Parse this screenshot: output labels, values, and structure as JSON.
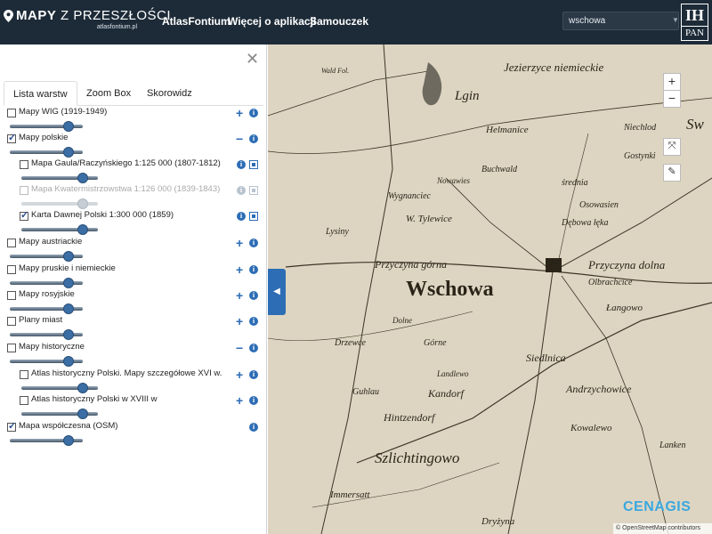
{
  "header": {
    "logo_bold": "MAPY",
    "logo_rest": " Z PRZESZŁOŚCI",
    "logo_sub": "atlasfontium.pl",
    "nav": [
      "AtlasFontium",
      "Więcej o aplikacji",
      "Samouczek"
    ],
    "search_value": "wschowa",
    "ihpan_top": "IH",
    "ihpan_bottom": "PAN"
  },
  "panel": {
    "tabs": [
      "Lista warstw",
      "Zoom Box",
      "Skorowidz"
    ],
    "active_tab": 0,
    "layers": [
      {
        "label": "Mapy WIG (1919-1949)",
        "checked": false,
        "opacity": 0.8,
        "action": "+"
      },
      {
        "label": "Mapy polskie",
        "checked": true,
        "opacity": 0.8,
        "action": "−"
      },
      {
        "label": "Mapa Gaula/Raczyńskiego 1:125 000 (1807-1812)",
        "checked": false,
        "opacity": 0.8
      },
      {
        "label": "Mapa Kwatermistrzowstwa 1:126 000 (1839-1843)",
        "checked": false,
        "opacity": 0.8,
        "disabled": true
      },
      {
        "label": "Karta Dawnej Polski 1:300 000 (1859)",
        "checked": true,
        "opacity": 0.8
      },
      {
        "label": "Mapy austriackie",
        "checked": false,
        "opacity": 0.8,
        "action": "+"
      },
      {
        "label": "Mapy pruskie i niemieckie",
        "checked": false,
        "opacity": 0.8,
        "action": "+"
      },
      {
        "label": "Mapy rosyjskie",
        "checked": false,
        "opacity": 0.8,
        "action": "+"
      },
      {
        "label": "Plany miast",
        "checked": false,
        "opacity": 0.8,
        "action": "+"
      },
      {
        "label": "Mapy historyczne",
        "checked": false,
        "opacity": 0.8,
        "action": "−"
      },
      {
        "label": "Atlas historyczny Polski. Mapy szczegółowe XVI w.",
        "checked": false,
        "opacity": 0.8,
        "action": "+"
      },
      {
        "label": "Atlas historyczny Polski w XVIII w",
        "checked": false,
        "opacity": 0.8,
        "action": "+"
      },
      {
        "label": "Mapa współczesna (OSM)",
        "checked": true,
        "opacity": 0.8
      }
    ]
  },
  "map": {
    "place_labels": [
      "Wschowa",
      "Lgin",
      "Jezierzyce niemieckie",
      "Helmanice",
      "Buchwald",
      "Nowawies",
      "Wygnanciec",
      "W. Tylewice",
      "Przyczyna górna",
      "Przyczyna dolna",
      "Olbrachcice",
      "Kandorf",
      "Hintzendorf",
      "Szlichtingowo",
      "Dryżyna",
      "Kowalewo",
      "Andrzychowice",
      "Siedlnica",
      "Górne",
      "Drzewce",
      "Łangowo",
      "Gostynki",
      "Niechlod",
      "Sw",
      "Lanken",
      "Immersatt",
      "Guhlau",
      "Wald Fol.",
      "średnia",
      "Osowasien",
      "Lysiny",
      "Dębowa łęka",
      "Dolne",
      "Landlewo"
    ],
    "attribution": "© OpenStreetMap contributors",
    "watermark": "CENAGIS"
  }
}
